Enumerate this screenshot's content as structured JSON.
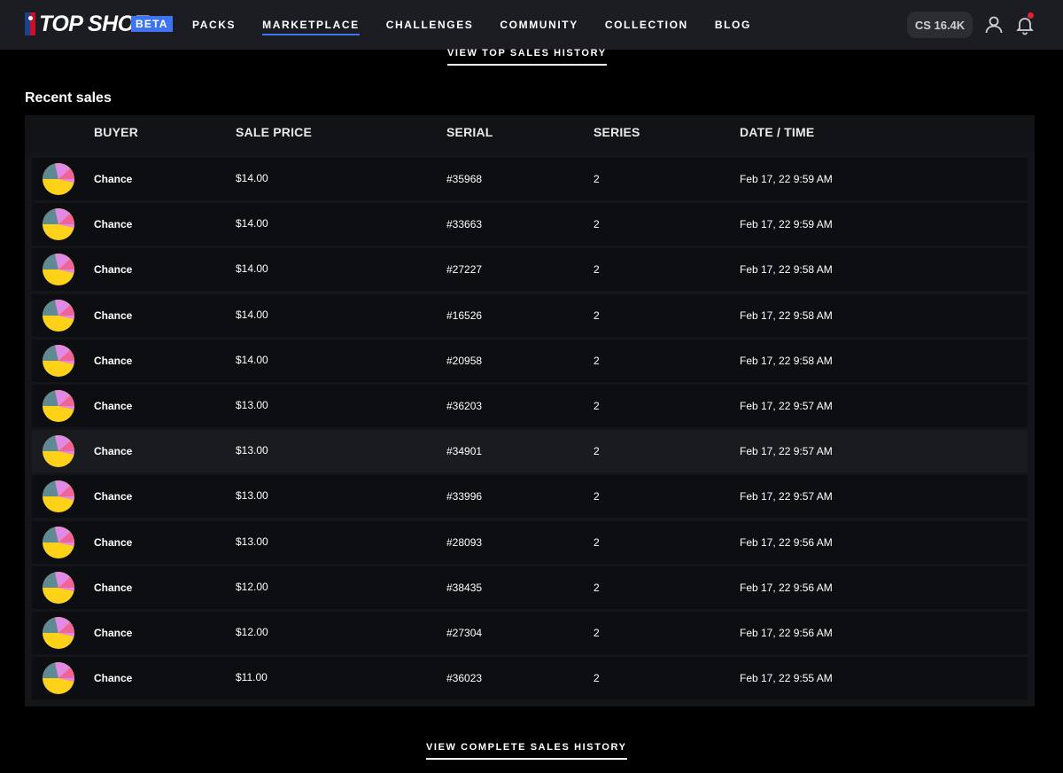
{
  "header": {
    "logo_text": "TOP SHOT",
    "beta": "BETA",
    "nav": [
      "PACKS",
      "MARKETPLACE",
      "CHALLENGES",
      "COMMUNITY",
      "COLLECTION",
      "BLOG"
    ],
    "active_nav": "MARKETPLACE",
    "balance": "CS 16.4K"
  },
  "links": {
    "top_sales": "VIEW TOP SALES HISTORY",
    "complete_sales": "VIEW COMPLETE SALES HISTORY"
  },
  "recent_sales": {
    "title": "Recent sales",
    "columns": [
      "BUYER",
      "SALE PRICE",
      "SERIAL",
      "SERIES",
      "DATE / TIME"
    ],
    "rows": [
      {
        "buyer": "Chance",
        "price": "$14.00",
        "serial": "#35968",
        "series": "2",
        "datetime": "Feb 17, 22 9:59 AM"
      },
      {
        "buyer": "Chance",
        "price": "$14.00",
        "serial": "#33663",
        "series": "2",
        "datetime": "Feb 17, 22 9:59 AM"
      },
      {
        "buyer": "Chance",
        "price": "$14.00",
        "serial": "#27227",
        "series": "2",
        "datetime": "Feb 17, 22 9:58 AM"
      },
      {
        "buyer": "Chance",
        "price": "$14.00",
        "serial": "#16526",
        "series": "2",
        "datetime": "Feb 17, 22 9:58 AM"
      },
      {
        "buyer": "Chance",
        "price": "$14.00",
        "serial": "#20958",
        "series": "2",
        "datetime": "Feb 17, 22 9:58 AM"
      },
      {
        "buyer": "Chance",
        "price": "$13.00",
        "serial": "#36203",
        "series": "2",
        "datetime": "Feb 17, 22 9:57 AM"
      },
      {
        "buyer": "Chance",
        "price": "$13.00",
        "serial": "#34901",
        "series": "2",
        "datetime": "Feb 17, 22 9:57 AM"
      },
      {
        "buyer": "Chance",
        "price": "$13.00",
        "serial": "#33996",
        "series": "2",
        "datetime": "Feb 17, 22 9:57 AM"
      },
      {
        "buyer": "Chance",
        "price": "$13.00",
        "serial": "#28093",
        "series": "2",
        "datetime": "Feb 17, 22 9:56 AM"
      },
      {
        "buyer": "Chance",
        "price": "$12.00",
        "serial": "#38435",
        "series": "2",
        "datetime": "Feb 17, 22 9:56 AM"
      },
      {
        "buyer": "Chance",
        "price": "$12.00",
        "serial": "#27304",
        "series": "2",
        "datetime": "Feb 17, 22 9:56 AM"
      },
      {
        "buyer": "Chance",
        "price": "$11.00",
        "serial": "#36023",
        "series": "2",
        "datetime": "Feb 17, 22 9:55 AM"
      }
    ],
    "highlighted_row": 6
  },
  "colors": {
    "accent": "#3d74f2",
    "avatar": [
      "#ffd21a",
      "#5f8a93",
      "#e08ae6",
      "#f0649a"
    ]
  },
  "icons": {
    "user": "user-icon",
    "bell": "bell-icon",
    "avatar": "avatar-icon"
  }
}
